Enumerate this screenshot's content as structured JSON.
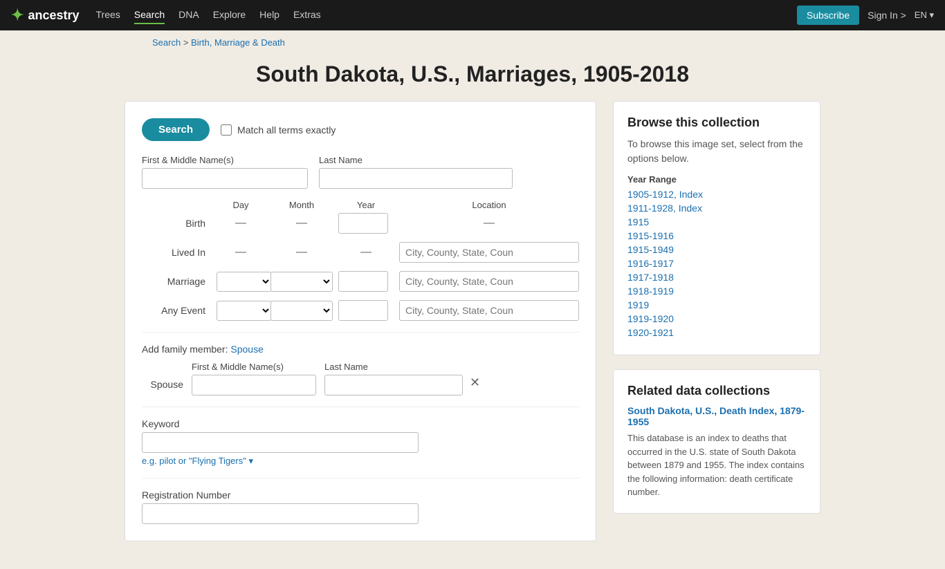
{
  "nav": {
    "logo_text": "ancestry",
    "logo_icon": "✦",
    "links": [
      "Trees",
      "Search",
      "DNA",
      "Explore",
      "Help",
      "Extras"
    ],
    "active_link": "Search",
    "subscribe_label": "Subscribe",
    "signin_label": "Sign In >",
    "lang_label": "EN ▾"
  },
  "breadcrumb": {
    "search_label": "Search",
    "separator": " > ",
    "category_label": "Birth, Marriage & Death"
  },
  "page_title": "South Dakota, U.S., Marriages, 1905-2018",
  "search_form": {
    "search_button": "Search",
    "match_exact_label": "Match all terms exactly",
    "first_middle_label": "First & Middle Name(s)",
    "last_name_label": "Last Name",
    "day_header": "Day",
    "month_header": "Month",
    "year_header": "Year",
    "location_header": "Location",
    "birth_label": "Birth",
    "lived_in_label": "Lived In",
    "marriage_label": "Marriage",
    "any_event_label": "Any Event",
    "location_placeholder": "City, County, State, Coun",
    "add_family_label": "Add family member:",
    "spouse_link": "Spouse",
    "spouse_label": "Spouse",
    "spouse_first_label": "First & Middle Name(s)",
    "spouse_last_label": "Last Name",
    "keyword_label": "Keyword",
    "keyword_placeholder": "",
    "keyword_hint": "e.g. pilot or \"Flying Tigers\" ▾",
    "reg_number_label": "Registration Number",
    "reg_placeholder": ""
  },
  "browse": {
    "title": "Browse this collection",
    "description": "To browse this image set, select from the options below.",
    "year_range_label": "Year Range",
    "year_ranges": [
      "1905-1912, Index",
      "1911-1928, Index",
      "1915",
      "1915-1916",
      "1915-1949",
      "1916-1917",
      "1917-1918",
      "1918-1919",
      "1919",
      "1919-1920",
      "1920-1921"
    ]
  },
  "related": {
    "title": "Related data collections",
    "link_text": "South Dakota, U.S., Death Index, 1879-1955",
    "description": "This database is an index to deaths that occurred in the U.S. state of South Dakota between 1879 and 1955. The index contains the following information: death certificate number."
  }
}
